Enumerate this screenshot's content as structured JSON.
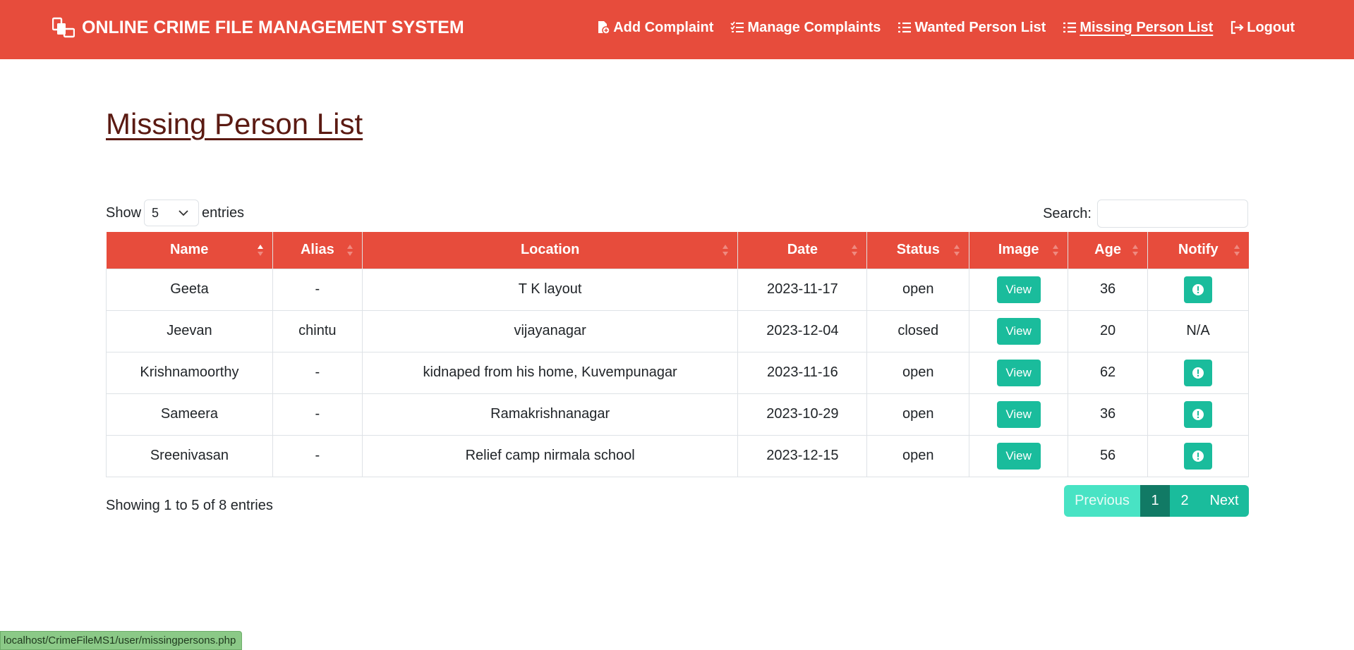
{
  "navbar": {
    "brand": "ONLINE CRIME FILE MANAGEMENT SYSTEM",
    "items": [
      {
        "label": "Add Complaint",
        "icon": "file-plus-icon"
      },
      {
        "label": "Manage Complaints",
        "icon": "list-check-icon"
      },
      {
        "label": "Wanted Person List",
        "icon": "list-icon"
      },
      {
        "label": "Missing Person List",
        "icon": "list-icon"
      },
      {
        "label": "Logout",
        "icon": "logout-icon"
      }
    ],
    "active": "Missing Person List"
  },
  "page": {
    "title": "Missing Person List"
  },
  "controls": {
    "show_label": "Show",
    "entries_value": "5",
    "entries_label": "entries",
    "search_label": "Search:",
    "search_value": ""
  },
  "table": {
    "columns": [
      "Name",
      "Alias",
      "Location",
      "Date",
      "Status",
      "Image",
      "Age",
      "Notify"
    ],
    "view_label": "View",
    "rows": [
      {
        "name": "Geeta",
        "alias": "-",
        "location": "T K layout",
        "date": "2023-11-17",
        "status": "open",
        "age": "36",
        "notify": "button"
      },
      {
        "name": "Jeevan",
        "alias": "chintu",
        "location": "vijayanagar",
        "date": "2023-12-04",
        "status": "closed",
        "age": "20",
        "notify": "N/A"
      },
      {
        "name": "Krishnamoorthy",
        "alias": "-",
        "location": "kidnaped from his home, Kuvempunagar",
        "date": "2023-11-16",
        "status": "open",
        "age": "62",
        "notify": "button"
      },
      {
        "name": "Sameera",
        "alias": "-",
        "location": "Ramakrishnanagar",
        "date": "2023-10-29",
        "status": "open",
        "age": "36",
        "notify": "button"
      },
      {
        "name": "Sreenivasan",
        "alias": "-",
        "location": "Relief camp nirmala school",
        "date": "2023-12-15",
        "status": "open",
        "age": "56",
        "notify": "button"
      }
    ]
  },
  "footer": {
    "info": "Showing 1 to 5 of 8 entries",
    "pagination": {
      "previous": "Previous",
      "pages": [
        "1",
        "2"
      ],
      "current": "1",
      "next": "Next"
    }
  },
  "statusbar": {
    "url": "localhost/CrimeFileMS1/user/missingpersons.php"
  },
  "colors": {
    "header": "#e74c3c",
    "accent": "#1abc9c",
    "title": "#5b1a12"
  }
}
